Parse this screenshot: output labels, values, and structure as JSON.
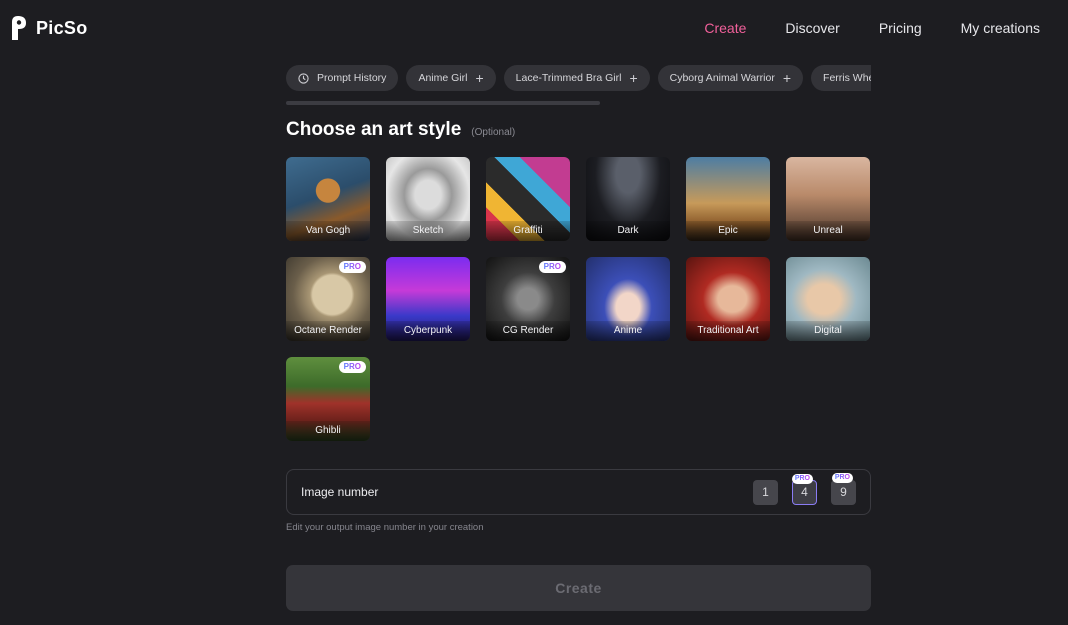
{
  "brand": {
    "name": "PicSo"
  },
  "nav": [
    {
      "label": "Create",
      "active": true
    },
    {
      "label": "Discover"
    },
    {
      "label": "Pricing"
    },
    {
      "label": "My creations"
    }
  ],
  "chips": {
    "history_label": "Prompt History",
    "prompts": [
      "Anime Girl",
      "Lace-Trimmed Bra Girl",
      "Cyborg Animal Warrior",
      "Ferris Whe"
    ]
  },
  "art_style": {
    "title": "Choose an art style",
    "optional_label": "(Optional)",
    "pro_badge": "PRO",
    "styles": [
      {
        "label": "Van Gogh",
        "pro": false
      },
      {
        "label": "Sketch",
        "pro": false
      },
      {
        "label": "Graffiti",
        "pro": false
      },
      {
        "label": "Dark",
        "pro": false
      },
      {
        "label": "Epic",
        "pro": false
      },
      {
        "label": "Unreal",
        "pro": false
      },
      {
        "label": "Octane Render",
        "pro": true
      },
      {
        "label": "Cyberpunk",
        "pro": false
      },
      {
        "label": "CG Render",
        "pro": true
      },
      {
        "label": "Anime",
        "pro": false
      },
      {
        "label": "Traditional Art",
        "pro": false
      },
      {
        "label": "Digital",
        "pro": false
      },
      {
        "label": "Ghibli",
        "pro": true
      }
    ]
  },
  "image_number": {
    "label": "Image number",
    "options": [
      "1",
      "4",
      "9"
    ],
    "selected": "4",
    "helper": "Edit your output image number in your creation"
  },
  "create_button": {
    "label": "Create"
  },
  "colors": {
    "accent": "#f0609a",
    "background": "#1d1d21",
    "chip": "#333338"
  }
}
